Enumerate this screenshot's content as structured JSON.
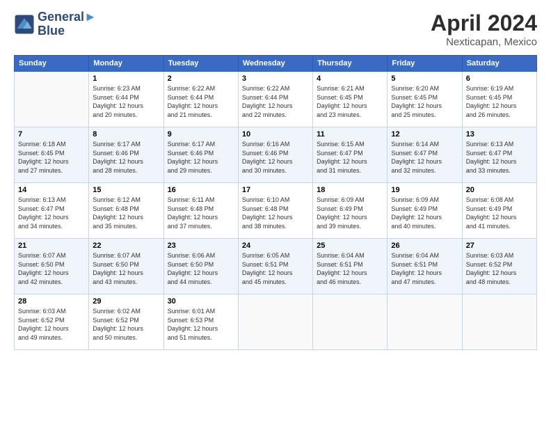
{
  "logo": {
    "line1": "General",
    "line2": "Blue"
  },
  "title": "April 2024",
  "subtitle": "Nexticapan, Mexico",
  "days_header": [
    "Sunday",
    "Monday",
    "Tuesday",
    "Wednesday",
    "Thursday",
    "Friday",
    "Saturday"
  ],
  "weeks": [
    [
      {
        "day": "",
        "content": ""
      },
      {
        "day": "1",
        "content": "Sunrise: 6:23 AM\nSunset: 6:44 PM\nDaylight: 12 hours\nand 20 minutes."
      },
      {
        "day": "2",
        "content": "Sunrise: 6:22 AM\nSunset: 6:44 PM\nDaylight: 12 hours\nand 21 minutes."
      },
      {
        "day": "3",
        "content": "Sunrise: 6:22 AM\nSunset: 6:44 PM\nDaylight: 12 hours\nand 22 minutes."
      },
      {
        "day": "4",
        "content": "Sunrise: 6:21 AM\nSunset: 6:45 PM\nDaylight: 12 hours\nand 23 minutes."
      },
      {
        "day": "5",
        "content": "Sunrise: 6:20 AM\nSunset: 6:45 PM\nDaylight: 12 hours\nand 25 minutes."
      },
      {
        "day": "6",
        "content": "Sunrise: 6:19 AM\nSunset: 6:45 PM\nDaylight: 12 hours\nand 26 minutes."
      }
    ],
    [
      {
        "day": "7",
        "content": "Sunrise: 6:18 AM\nSunset: 6:45 PM\nDaylight: 12 hours\nand 27 minutes."
      },
      {
        "day": "8",
        "content": "Sunrise: 6:17 AM\nSunset: 6:46 PM\nDaylight: 12 hours\nand 28 minutes."
      },
      {
        "day": "9",
        "content": "Sunrise: 6:17 AM\nSunset: 6:46 PM\nDaylight: 12 hours\nand 29 minutes."
      },
      {
        "day": "10",
        "content": "Sunrise: 6:16 AM\nSunset: 6:46 PM\nDaylight: 12 hours\nand 30 minutes."
      },
      {
        "day": "11",
        "content": "Sunrise: 6:15 AM\nSunset: 6:47 PM\nDaylight: 12 hours\nand 31 minutes."
      },
      {
        "day": "12",
        "content": "Sunrise: 6:14 AM\nSunset: 6:47 PM\nDaylight: 12 hours\nand 32 minutes."
      },
      {
        "day": "13",
        "content": "Sunrise: 6:13 AM\nSunset: 6:47 PM\nDaylight: 12 hours\nand 33 minutes."
      }
    ],
    [
      {
        "day": "14",
        "content": "Sunrise: 6:13 AM\nSunset: 6:47 PM\nDaylight: 12 hours\nand 34 minutes."
      },
      {
        "day": "15",
        "content": "Sunrise: 6:12 AM\nSunset: 6:48 PM\nDaylight: 12 hours\nand 35 minutes."
      },
      {
        "day": "16",
        "content": "Sunrise: 6:11 AM\nSunset: 6:48 PM\nDaylight: 12 hours\nand 37 minutes."
      },
      {
        "day": "17",
        "content": "Sunrise: 6:10 AM\nSunset: 6:48 PM\nDaylight: 12 hours\nand 38 minutes."
      },
      {
        "day": "18",
        "content": "Sunrise: 6:09 AM\nSunset: 6:49 PM\nDaylight: 12 hours\nand 39 minutes."
      },
      {
        "day": "19",
        "content": "Sunrise: 6:09 AM\nSunset: 6:49 PM\nDaylight: 12 hours\nand 40 minutes."
      },
      {
        "day": "20",
        "content": "Sunrise: 6:08 AM\nSunset: 6:49 PM\nDaylight: 12 hours\nand 41 minutes."
      }
    ],
    [
      {
        "day": "21",
        "content": "Sunrise: 6:07 AM\nSunset: 6:50 PM\nDaylight: 12 hours\nand 42 minutes."
      },
      {
        "day": "22",
        "content": "Sunrise: 6:07 AM\nSunset: 6:50 PM\nDaylight: 12 hours\nand 43 minutes."
      },
      {
        "day": "23",
        "content": "Sunrise: 6:06 AM\nSunset: 6:50 PM\nDaylight: 12 hours\nand 44 minutes."
      },
      {
        "day": "24",
        "content": "Sunrise: 6:05 AM\nSunset: 6:51 PM\nDaylight: 12 hours\nand 45 minutes."
      },
      {
        "day": "25",
        "content": "Sunrise: 6:04 AM\nSunset: 6:51 PM\nDaylight: 12 hours\nand 46 minutes."
      },
      {
        "day": "26",
        "content": "Sunrise: 6:04 AM\nSunset: 6:51 PM\nDaylight: 12 hours\nand 47 minutes."
      },
      {
        "day": "27",
        "content": "Sunrise: 6:03 AM\nSunset: 6:52 PM\nDaylight: 12 hours\nand 48 minutes."
      }
    ],
    [
      {
        "day": "28",
        "content": "Sunrise: 6:03 AM\nSunset: 6:52 PM\nDaylight: 12 hours\nand 49 minutes."
      },
      {
        "day": "29",
        "content": "Sunrise: 6:02 AM\nSunset: 6:52 PM\nDaylight: 12 hours\nand 50 minutes."
      },
      {
        "day": "30",
        "content": "Sunrise: 6:01 AM\nSunset: 6:53 PM\nDaylight: 12 hours\nand 51 minutes."
      },
      {
        "day": "",
        "content": ""
      },
      {
        "day": "",
        "content": ""
      },
      {
        "day": "",
        "content": ""
      },
      {
        "day": "",
        "content": ""
      }
    ]
  ]
}
